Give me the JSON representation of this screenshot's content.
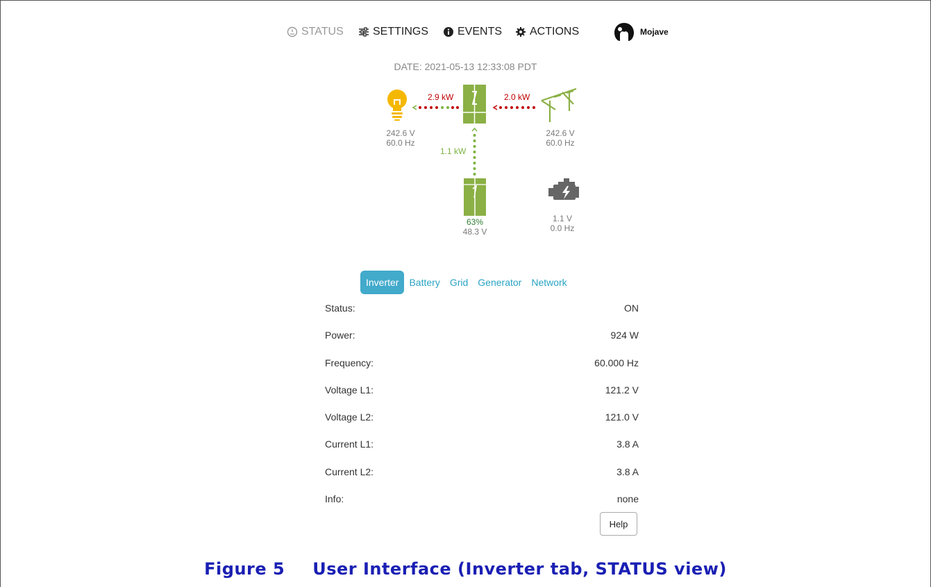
{
  "nav": {
    "status": "STATUS",
    "settings": "SETTINGS",
    "events": "EVENTS",
    "actions": "ACTIONS",
    "brand": "Mojave"
  },
  "date": "DATE: 2021-05-13 12:33:08 PDT",
  "diagram": {
    "load": {
      "voltage": "242.6 V",
      "frequency": "60.0 Hz",
      "power": "2.9 kW",
      "icon": "lightbulb-icon"
    },
    "grid": {
      "voltage": "242.6 V",
      "frequency": "60.0 Hz",
      "power": "2.0 kW",
      "icon": "power-pole-icon"
    },
    "battery": {
      "soc": "63%",
      "voltage": "48.3 V",
      "power": "1.1 kW",
      "icon": "battery-icon"
    },
    "generator": {
      "voltage": "1.1 V",
      "frequency": "0.0 Hz",
      "icon": "engine-icon"
    },
    "inverter": {
      "icon": "inverter-icon"
    }
  },
  "tabs": [
    "Inverter",
    "Battery",
    "Grid",
    "Generator",
    "Network"
  ],
  "active_tab": "Inverter",
  "inverter_table": [
    {
      "label": "Status:",
      "value": "ON"
    },
    {
      "label": "Power:",
      "value": "924 W"
    },
    {
      "label": "Frequency:",
      "value": "60.000 Hz"
    },
    {
      "label": "Voltage L1:",
      "value": "121.2 V"
    },
    {
      "label": "Voltage L2:",
      "value": "121.0 V"
    },
    {
      "label": "Current L1:",
      "value": "3.8 A"
    },
    {
      "label": "Current L2:",
      "value": "3.8 A"
    },
    {
      "label": "Info:",
      "value": "none"
    }
  ],
  "help_label": "Help",
  "caption": {
    "number": "Figure 5",
    "text": "User Interface (Inverter tab, STATUS view)"
  },
  "colors": {
    "accent": "#42aacb",
    "flow_red": "#c00000",
    "flow_green": "#7cb342",
    "load": "#f5b800",
    "device": "#8bb045",
    "generator": "#666666"
  }
}
